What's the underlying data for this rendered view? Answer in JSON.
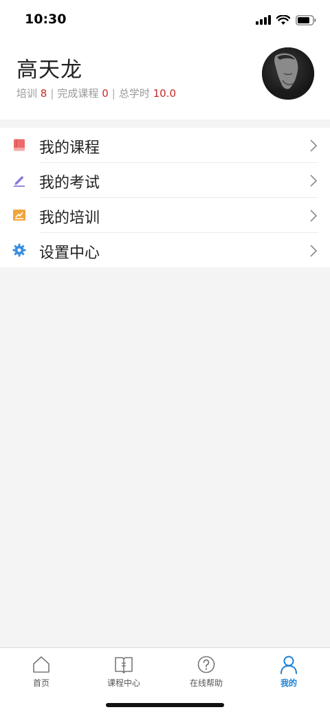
{
  "status_bar": {
    "time": "10:30"
  },
  "profile": {
    "name": "高天龙",
    "stats": [
      {
        "label": "培训",
        "value": "8"
      },
      {
        "label": "完成课程",
        "value": "0"
      },
      {
        "label": "总学时",
        "value": "10.0"
      }
    ],
    "separator": "|"
  },
  "menu": {
    "items": [
      {
        "label": "我的课程",
        "icon": "book-icon",
        "color": "#ee6b6b"
      },
      {
        "label": "我的考试",
        "icon": "pencil-icon",
        "color": "#8b79d9"
      },
      {
        "label": "我的培训",
        "icon": "training-icon",
        "color": "#f2a33a"
      },
      {
        "label": "设置中心",
        "icon": "gear-icon",
        "color": "#3a8fe0"
      }
    ]
  },
  "tabbar": {
    "items": [
      {
        "label": "首页",
        "icon": "home-icon",
        "active": false
      },
      {
        "label": "课程中心",
        "icon": "open-book-icon",
        "active": false
      },
      {
        "label": "在线帮助",
        "icon": "help-icon",
        "active": false
      },
      {
        "label": "我的",
        "icon": "user-icon",
        "active": true
      }
    ],
    "active_color": "#1a7fd4"
  }
}
